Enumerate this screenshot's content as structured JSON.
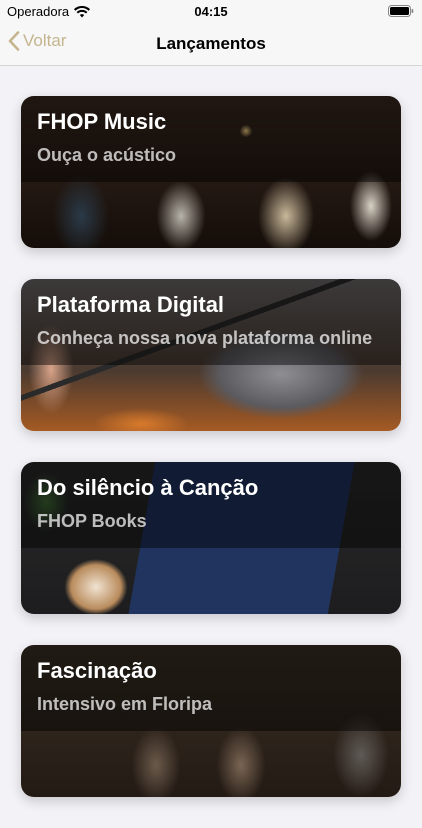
{
  "status_bar": {
    "carrier": "Operadora",
    "time": "04:15"
  },
  "nav": {
    "back_label": "Voltar",
    "title": "Lançamentos"
  },
  "colors": {
    "accent": "#c4b58e",
    "background": "#f2f2f7"
  },
  "cards": [
    {
      "title": "FHOP Music",
      "subtitle": "Ouça o acústico"
    },
    {
      "title": "Plataforma Digital",
      "subtitle": "Conheça nossa nova plataforma online"
    },
    {
      "title": "Do silêncio à Canção",
      "subtitle": "FHOP Books"
    },
    {
      "title": "Fascinação",
      "subtitle": "Intensivo em Floripa"
    }
  ]
}
